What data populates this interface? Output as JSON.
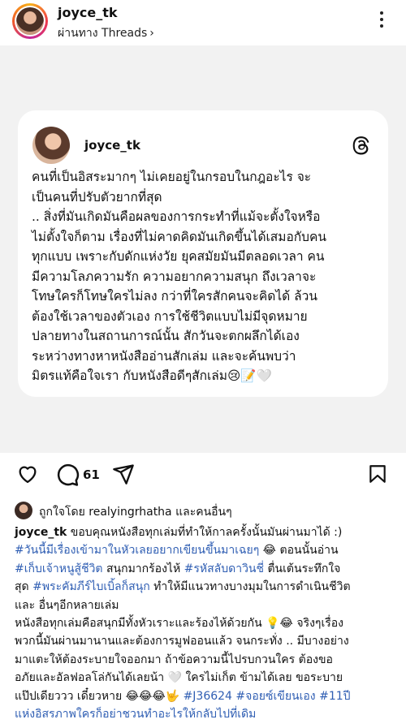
{
  "header": {
    "username": "joyce_tk",
    "via_prefix": "ผ่านทาง",
    "via_app": "Threads",
    "chevron": "›"
  },
  "card": {
    "username": "joyce_tk",
    "icon": "threads-logo-icon",
    "text": "คนที่เป็นอิสระมากๆ ไม่เคยอยู่ในกรอบในกฎอะไร จะ\nเป็นคนที่ปรับตัวยากที่สุด\n.. สิ่งที่มันเกิดมันคือผลของการกระทำที่แม้จะตั้งใจหรือ\nไม่ตั้งใจก็ตาม เรื่องที่ไม่คาดคิดมันเกิดขึ้นได้เสมอกับคน\nทุกแบบ เพราะกับดักแห่งวัย ยุคสมัยมันมีตลอดเวลา คน\nมีความโลภความรัก ความอยากความสนุก ถึงเวลาจะ\nโทษใครก็โทษใครไม่ลง กว่าที่ใครสักคนจะคิดได้ ล้วน\nต้องใช้เวลาของตัวเอง การใช้ชีวิตแบบไม่มีจุดหมาย\nปลายทางในสถานการณ์นั้น สักวันจะตกผลึกได้เอง\nระหว่างทางหาหนังสืออ่านสักเล่ม และจะค้นพบว่า\nมิตรแท้คือใจเรา กับหนังสือดีๆสักเล่ม😢📝🤍"
  },
  "actions": {
    "like_icon": "heart-outline-icon",
    "comment_icon": "comment-icon",
    "comment_count": "61",
    "share_icon": "send-icon",
    "save_icon": "bookmark-icon"
  },
  "likes": {
    "prefix": "ถูกใจโดย",
    "user": "realyingrhatha",
    "suffix": "และคนอื่นๆ"
  },
  "caption": {
    "username": "joyce_tk",
    "p1": " ขอบคุณหนังสือทุกเล่มที่ทำให้กาลครั้งนั้นมันผ่านมาได้ :)\n",
    "tag1": "#วันนี้มีเรื่องเข้ามาในหัวเลยอยากเขียนขึ้นมาเฉยๆ",
    "p2": " 😂 ตอนนั้นอ่าน\n",
    "tag2": "#เก็บเจ้าหนูสู้ชีวิต",
    "p3": " สนุกมากร้องไห้ ",
    "tag3": "#รหัสลับดาวินชี่",
    "p4": " ตื่นเต้นระทึกใจ\nสุด ",
    "tag4": "#พระคัมภีร์ไบเบิ้ลก็สนุก",
    "p5": " ทำให้มีแนวทางบางมุมในการดำเนินชีวิต\nและ อื่นๆอีกหลายเล่ม\nหนังสือทุกเล่มคือสนุกมีทั้งหัวเราะและร้องไห้ด้วยกัน 💡😂 จริงๆเรื่อง\nพวกนี้มันผ่านมานานและต้องการมูฟออนแล้ว จนกระทั่ง .. มีบางอย่าง\nมาแตะให้ต้องระบายใจออกมา ถ้าข้อความนี้ไปรบกวนใคร ต้องขอ\nอภัยและอัลฟอลโล่กันได้เลยน้า 🤍 ใครไม่เก็ต ข้ามได้เลย ขอระบาย\nแป๊ปเดียววว เดี๋ยวหาย 😂😂😂🤟 ",
    "tag5": "#J36624",
    "p6": " ",
    "tag6": "#จอยซ์เขียนเอง",
    "p7": " ",
    "tag7": "#11ปี\nแห่งอิสรภาพใครก็อย่าชวนทำอะไรให้กลับไปที่เดิม"
  },
  "colors": {
    "hashtag": "#2f5eb3",
    "media_bg": "#f2f2f2"
  }
}
